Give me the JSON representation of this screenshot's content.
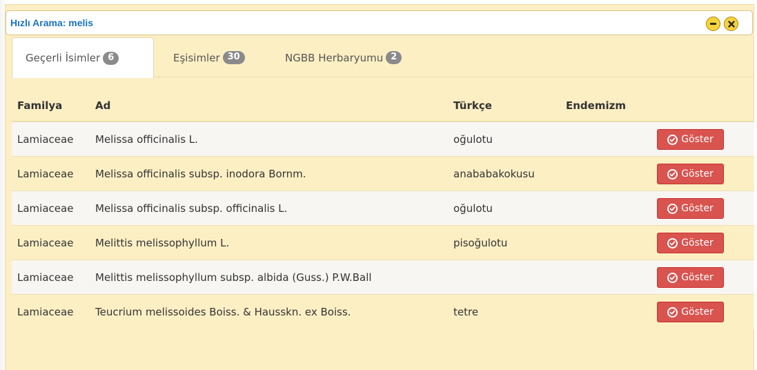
{
  "dialog": {
    "title": "Hızlı Arama: melis",
    "minimize_icon": "minus-icon",
    "close_icon": "close-icon"
  },
  "tabs": [
    {
      "label": "Geçerli İsimler",
      "count": "6",
      "active": true
    },
    {
      "label": "Eşisimler",
      "count": "30",
      "active": false
    },
    {
      "label": "NGBB Herbaryumu",
      "count": "2",
      "active": false
    }
  ],
  "table": {
    "headers": [
      "Familya",
      "Ad",
      "Türkçe",
      "Endemizm"
    ],
    "rows": [
      {
        "familya": "Lamiaceae",
        "ad": "Melissa officinalis L.",
        "turkce": "oğulotu",
        "endemizm": "",
        "button": "Göster"
      },
      {
        "familya": "Lamiaceae",
        "ad": "Melissa officinalis subsp. inodora Bornm.",
        "turkce": "anababakokusu",
        "endemizm": "",
        "button": "Göster"
      },
      {
        "familya": "Lamiaceae",
        "ad": "Melissa officinalis subsp. officinalis L.",
        "turkce": "oğulotu",
        "endemizm": "",
        "button": "Göster"
      },
      {
        "familya": "Lamiaceae",
        "ad": "Melittis melissophyllum L.",
        "turkce": "pisoğulotu",
        "endemizm": "",
        "button": "Göster"
      },
      {
        "familya": "Lamiaceae",
        "ad": "Melittis melissophyllum subsp. albida (Guss.) P.W.Ball",
        "turkce": "",
        "endemizm": "",
        "button": "Göster"
      },
      {
        "familya": "Lamiaceae",
        "ad": "Teucrium melissoides Boiss. & Hausskn. ex Boiss.",
        "turkce": "tetre",
        "endemizm": "",
        "button": "Göster"
      }
    ]
  },
  "colors": {
    "title": "#1a73c0",
    "dialog_bg": "#fdefc4",
    "button_bg": "#d9534f",
    "badge_bg": "#8a8a8a",
    "window_btn": "#f7d23a"
  }
}
